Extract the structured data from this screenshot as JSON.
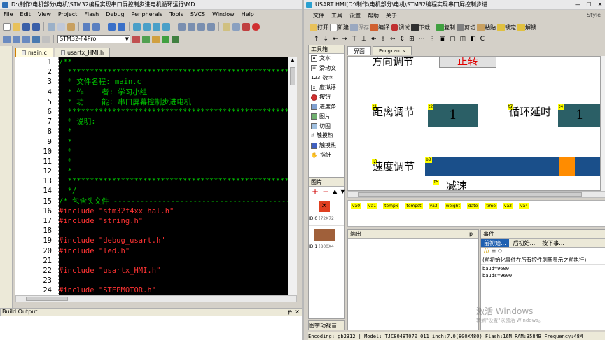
{
  "left_title": "D:\\制作\\电机部分\\电机\\STM32编程实现串口屏控制步进电机循环运行\\MD...",
  "right_title": "USART HMI[D:\\制作\\电机部分\\电机\\STM32编程实现串口屏控制步进...",
  "left_menu": [
    "File",
    "Edit",
    "View",
    "Project",
    "Flash",
    "Debug",
    "Peripherals",
    "Tools",
    "SVCS",
    "Window",
    "Help"
  ],
  "target_select": "STM32-F4Pro",
  "editor_tabs": [
    "main.c",
    "usartx_HMI.h"
  ],
  "code_lines": [
    {
      "n": "1",
      "t": "/**",
      "c": "comment"
    },
    {
      "n": "2",
      "t": "  *************************************************************",
      "c": "comment"
    },
    {
      "n": "3",
      "t": "  * 文件名程: main.c",
      "c": "comment"
    },
    {
      "n": "4",
      "t": "  * 作    者: 学习小组",
      "c": "comment"
    },
    {
      "n": "5",
      "t": "  * 功    能: 串口屏幕控制步进电机",
      "c": "comment"
    },
    {
      "n": "6",
      "t": "  *************************************************************",
      "c": "comment"
    },
    {
      "n": "7",
      "t": "  * 说明:",
      "c": "comment"
    },
    {
      "n": "8",
      "t": "  *",
      "c": "comment"
    },
    {
      "n": "9",
      "t": "  *",
      "c": "comment"
    },
    {
      "n": "10",
      "t": "  *",
      "c": "comment"
    },
    {
      "n": "11",
      "t": "  *",
      "c": "comment"
    },
    {
      "n": "12",
      "t": "  *",
      "c": "comment"
    },
    {
      "n": "13",
      "t": "  *************************************************************",
      "c": "comment"
    },
    {
      "n": "14",
      "t": "  */",
      "c": "comment"
    },
    {
      "n": "15",
      "t": "/* 包含头文件 ----------------------------------------------------",
      "c": "comment"
    },
    {
      "n": "16",
      "kw": "#include",
      "s": " \"stm32f4xx_hal.h\""
    },
    {
      "n": "17",
      "kw": "#include",
      "s": " \"string.h\""
    },
    {
      "n": "18",
      "t": "",
      "c": "comment"
    },
    {
      "n": "19",
      "kw": "#include",
      "s": " \"debug_usart.h\""
    },
    {
      "n": "20",
      "kw": "#include",
      "s": " \"led.h\""
    },
    {
      "n": "21",
      "t": "",
      "c": "comment"
    },
    {
      "n": "22",
      "kw": "#include",
      "s": " \"usartx_HMI.h\""
    },
    {
      "n": "23",
      "t": "",
      "c": "comment"
    },
    {
      "n": "24",
      "kw": "#include",
      "s": " \"STEPMOTOR.h\""
    }
  ],
  "build_output_label": "Build Output",
  "right_menu": [
    "文件",
    "工具",
    "设置",
    "帮助",
    "关于"
  ],
  "right_toolbar": [
    "打开",
    "新建",
    "保存",
    "编译",
    "调试",
    "下载",
    "复制",
    "剪切",
    "粘贴",
    "锁定",
    "解锁"
  ],
  "toolbox_title": "工具箱",
  "toolbox_items": [
    "文本",
    "滑动文",
    "数字",
    "虚拟浮",
    "按钮",
    "进度条",
    "图片",
    "切图",
    "触摸热",
    "触摸热",
    "指针"
  ],
  "pictures_title": "图片",
  "pictures": [
    {
      "id": "ID:0",
      "info": "(72X72"
    },
    {
      "id": "ID:1",
      "info": "(800X4"
    }
  ],
  "bottom_left_tabs": "图字动视音",
  "canvas_tabs": [
    "界面",
    "Program.s"
  ],
  "style_label": "Style",
  "canvas": {
    "t_dir": "方向调节",
    "btn_dir": "正转",
    "t_dist": "距离调节",
    "dist_val": "1",
    "t_loop": "循环延时",
    "loop_val": "1",
    "t_speed": "速度调节",
    "speed_progress": 0.85,
    "dec_label": "减速",
    "ids": [
      "t1",
      "t2",
      "t7",
      "t4",
      "t0",
      "b2",
      "t5"
    ]
  },
  "attrs": [
    "va0",
    "va1",
    "tempx",
    "tempst",
    "va3",
    "weight",
    "date",
    "time",
    "va2",
    "va4"
  ],
  "output_title": "输出",
  "events_title": "事件",
  "event_tabs": [
    "前初始...",
    "后初始...",
    "按下事..."
  ],
  "event_desc": "(前初始化事件在所有控件刷新显示之前执行)",
  "event_code": [
    "baud=9600",
    "bauds=9600"
  ],
  "watermark": "激活 Windows",
  "watermark_sub": "转到\"设置\"以激活 Windows。",
  "status": {
    "encoding": "Encoding: gb2312",
    "model": "Model: TJC8048T070_011",
    "inch": "inch:7.0(800X480)",
    "flash": "Flash:16M",
    "ram": "RAM:3584B",
    "freq": "Frequency:48M"
  },
  "colors": {
    "progress_bg": "#1a4f8a",
    "progress_thumb": "#ff8c00",
    "numbox": "#2b5f66",
    "btn_text": "#e00000"
  }
}
